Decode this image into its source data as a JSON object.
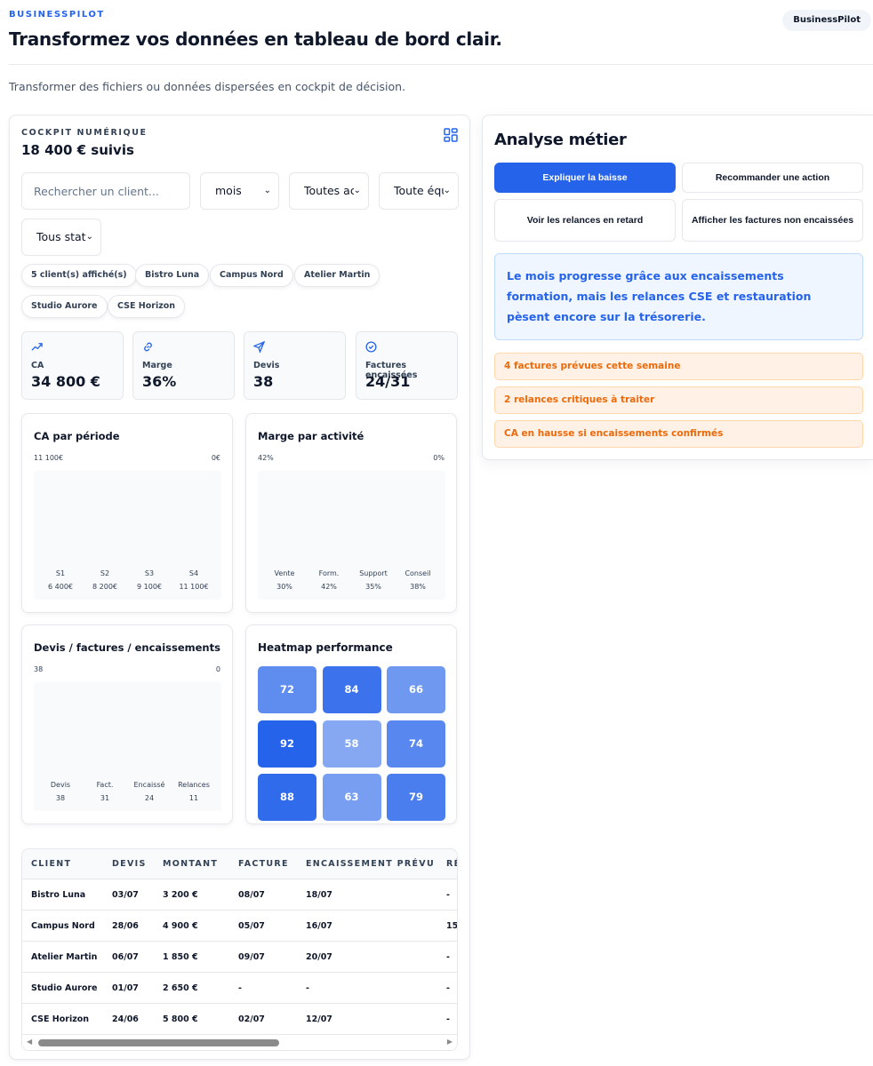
{
  "header": {
    "brand_label": "BUSINESSPILOT",
    "title": "Transformez vos données en tableau de bord clair.",
    "brand_pill": "BusinessPilot",
    "subtitle": "Transformer des fichiers ou données dispersées en cockpit de décision."
  },
  "cockpit": {
    "label": "COCKPIT NUMÉRIQUE",
    "value": "18 400 € suivis",
    "grid_icon": "grid-icon"
  },
  "filters": {
    "search_placeholder": "Rechercher un client...",
    "period": "mois",
    "activity": "Toutes activités",
    "team": "Toute équipe",
    "status": "Tous statuts"
  },
  "chips": [
    "5 client(s) affiché(s)",
    "Bistro Luna",
    "Campus Nord",
    "Atelier Martin",
    "Studio Aurore",
    "CSE Horizon"
  ],
  "kpis": [
    {
      "icon": "trending-up-icon",
      "label": "CA",
      "value": "34 800 €"
    },
    {
      "icon": "link-icon",
      "label": "Marge",
      "value": "36%"
    },
    {
      "icon": "send-icon",
      "label": "Devis",
      "value": "38"
    },
    {
      "icon": "check-circle-icon",
      "label": "Factures encaissées",
      "value": "24/31"
    }
  ],
  "chart_data": [
    {
      "type": "bar",
      "title": "CA par période",
      "axis_left": "11 100€",
      "axis_right": "0€",
      "categories": [
        "S1",
        "S2",
        "S3",
        "S4"
      ],
      "value_labels": [
        "6 400€",
        "8 200€",
        "9 100€",
        "11 100€"
      ],
      "values": [
        6400,
        8200,
        9100,
        11100
      ]
    },
    {
      "type": "bar",
      "title": "Marge par activité",
      "axis_left": "42%",
      "axis_right": "0%",
      "categories": [
        "Vente",
        "Form.",
        "Support",
        "Conseil"
      ],
      "value_labels": [
        "30%",
        "42%",
        "35%",
        "38%"
      ],
      "values": [
        30,
        42,
        35,
        38
      ]
    },
    {
      "type": "bar",
      "title": "Devis / factures / encaissements",
      "axis_left": "38",
      "axis_right": "0",
      "categories": [
        "Devis",
        "Fact.",
        "Encaissé",
        "Relances"
      ],
      "value_labels": [
        "38",
        "31",
        "24",
        "11"
      ],
      "values": [
        38,
        31,
        24,
        11
      ]
    },
    {
      "type": "heatmap",
      "title": "Heatmap performance",
      "values": [
        [
          72,
          84,
          66
        ],
        [
          92,
          58,
          74
        ],
        [
          88,
          63,
          79
        ]
      ]
    }
  ],
  "table": {
    "headers": [
      "CLIENT",
      "DEVIS",
      "MONTANT",
      "FACTURE",
      "ENCAISSEMENT PRÉVU",
      "RÉ"
    ],
    "rows": [
      [
        "Bistro Luna",
        "03/07",
        "3 200 €",
        "08/07",
        "18/07",
        "-"
      ],
      [
        "Campus Nord",
        "28/06",
        "4 900 €",
        "05/07",
        "16/07",
        "15"
      ],
      [
        "Atelier Martin",
        "06/07",
        "1 850 €",
        "09/07",
        "20/07",
        "-"
      ],
      [
        "Studio Aurore",
        "01/07",
        "2 650 €",
        "-",
        "-",
        "-"
      ],
      [
        "CSE Horizon",
        "24/06",
        "5 800 €",
        "02/07",
        "12/07",
        "-"
      ]
    ]
  },
  "analysis": {
    "title": "Analyse métier",
    "actions": [
      "Expliquer la baisse",
      "Recommander une action",
      "Voir les relances en retard",
      "Afficher les factures non encaissées"
    ],
    "insight": "Le mois progresse grâce aux encaissements formation, mais les relances CSE et restauration pèsent encore sur la trésorerie.",
    "alerts": [
      "4 factures prévues cette semaine",
      "2 relances critiques à traiter",
      "CA en hausse si encaissements confirmés"
    ]
  },
  "colors": {
    "accent": "#2563eb",
    "alert_text": "#ea6a0c",
    "alert_bg": "#fff1e6"
  }
}
